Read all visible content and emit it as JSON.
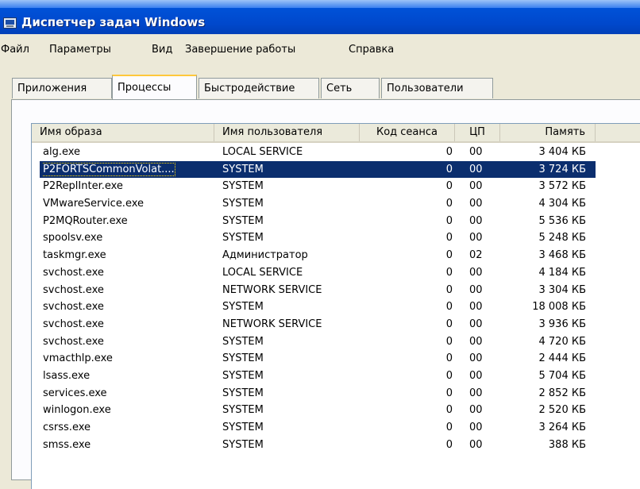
{
  "window": {
    "title": "Диспетчер задач Windows",
    "icon": "task-manager-icon"
  },
  "menu": [
    "Файл",
    "Параметры",
    "Вид",
    "Завершение работы",
    "Справка"
  ],
  "tabs": [
    {
      "label": "Приложения",
      "active": false
    },
    {
      "label": "Процессы",
      "active": true
    },
    {
      "label": "Быстродействие",
      "active": false
    },
    {
      "label": "Сеть",
      "active": false
    },
    {
      "label": "Пользователи",
      "active": false
    }
  ],
  "columns": [
    "Имя образа",
    "Имя пользователя",
    "Код сеанса",
    "ЦП",
    "Память"
  ],
  "selected_row": 1,
  "processes": [
    {
      "name": "alg.exe",
      "user": "LOCAL SERVICE",
      "session": "0",
      "cpu": "00",
      "memory": "3 404 КБ"
    },
    {
      "name": "P2FORTSCommonVolat....",
      "user": "SYSTEM",
      "session": "0",
      "cpu": "00",
      "memory": "3 724 КБ"
    },
    {
      "name": "P2ReplInter.exe",
      "user": "SYSTEM",
      "session": "0",
      "cpu": "00",
      "memory": "3 572 КБ"
    },
    {
      "name": "VMwareService.exe",
      "user": "SYSTEM",
      "session": "0",
      "cpu": "00",
      "memory": "4 304 КБ"
    },
    {
      "name": "P2MQRouter.exe",
      "user": "SYSTEM",
      "session": "0",
      "cpu": "00",
      "memory": "5 536 КБ"
    },
    {
      "name": "spoolsv.exe",
      "user": "SYSTEM",
      "session": "0",
      "cpu": "00",
      "memory": "5 248 КБ"
    },
    {
      "name": "taskmgr.exe",
      "user": "Администратор",
      "session": "0",
      "cpu": "02",
      "memory": "3 468 КБ"
    },
    {
      "name": "svchost.exe",
      "user": "LOCAL SERVICE",
      "session": "0",
      "cpu": "00",
      "memory": "4 184 КБ"
    },
    {
      "name": "svchost.exe",
      "user": "NETWORK SERVICE",
      "session": "0",
      "cpu": "00",
      "memory": "3 304 КБ"
    },
    {
      "name": "svchost.exe",
      "user": "SYSTEM",
      "session": "0",
      "cpu": "00",
      "memory": "18 008 КБ"
    },
    {
      "name": "svchost.exe",
      "user": "NETWORK SERVICE",
      "session": "0",
      "cpu": "00",
      "memory": "3 936 КБ"
    },
    {
      "name": "svchost.exe",
      "user": "SYSTEM",
      "session": "0",
      "cpu": "00",
      "memory": "4 720 КБ"
    },
    {
      "name": "vmacthlp.exe",
      "user": "SYSTEM",
      "session": "0",
      "cpu": "00",
      "memory": "2 444 КБ"
    },
    {
      "name": "lsass.exe",
      "user": "SYSTEM",
      "session": "0",
      "cpu": "00",
      "memory": "5 704 КБ"
    },
    {
      "name": "services.exe",
      "user": "SYSTEM",
      "session": "0",
      "cpu": "00",
      "memory": "2 852 КБ"
    },
    {
      "name": "winlogon.exe",
      "user": "SYSTEM",
      "session": "0",
      "cpu": "00",
      "memory": "2 520 КБ"
    },
    {
      "name": "csrss.exe",
      "user": "SYSTEM",
      "session": "0",
      "cpu": "00",
      "memory": "3 264 КБ"
    },
    {
      "name": "smss.exe",
      "user": "SYSTEM",
      "session": "0",
      "cpu": "00",
      "memory": "388 КБ"
    }
  ],
  "colors": {
    "title_bar": "#0a52d8",
    "selection": "#0b2e6e",
    "active_tab_accent": "#ffc83c"
  }
}
